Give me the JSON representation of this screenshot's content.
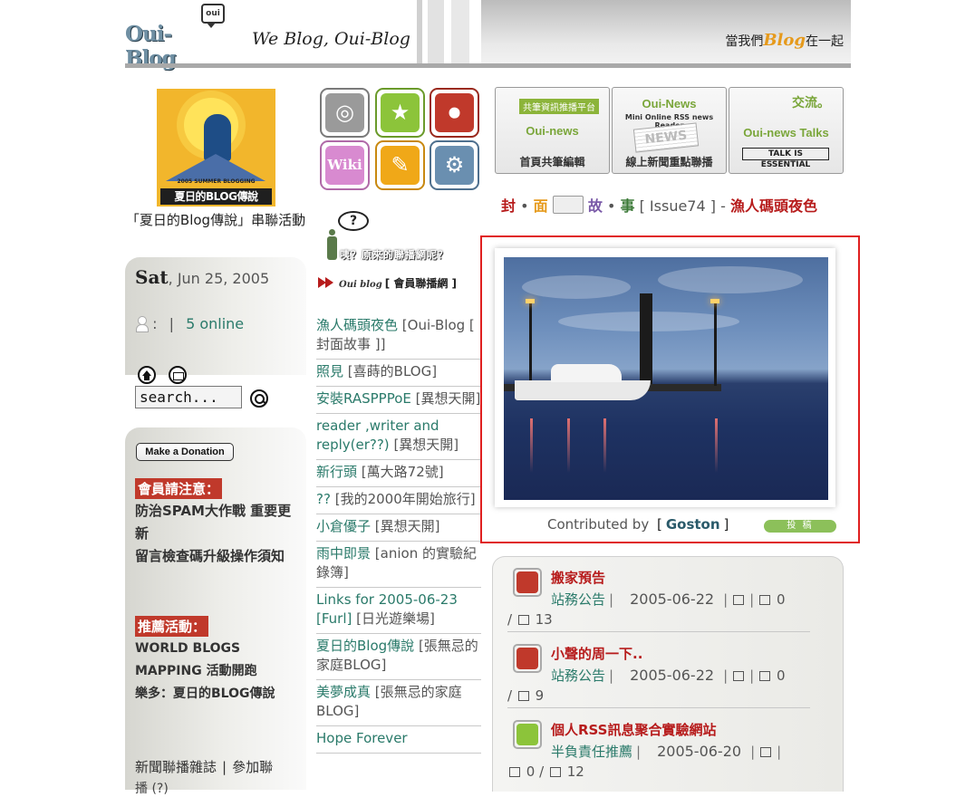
{
  "header": {
    "logo_text": "Oui-Blog",
    "logo_box": "oui",
    "slogan": "We Blog, Oui-Blog .",
    "tagline_pre": "當我們",
    "tagline_blog": "Blog",
    "tagline_post": "在一起"
  },
  "left": {
    "promo_small": "2005 SUMMER BLOGGING",
    "promo_banner": "夏日的BLOG傳說",
    "promo_caption": "「夏日的Blog傳說」串聯活動",
    "date_day": "Sat",
    "date_rest": ", Jun 25, 2005",
    "online_colon": ":",
    "online_sep": "|",
    "online_text": "5 online",
    "search_placeholder": "search...",
    "donate_label": "Make a Donation",
    "notice_head": "會員請注意：",
    "notices": [
      "防治SPAM大作戰 重要更新",
      "留言檢查碼升級操作須知"
    ],
    "promo_head": "推薦活動：",
    "promos": [
      "WORLD BLOGS MAPPING 活動開跑",
      "樂多：夏日的BLOG傳說"
    ],
    "footer_link1": "新聞聯播雜誌",
    "footer_sep": "|",
    "footer_link2": "參加聯",
    "footer_line2": "播 (?)"
  },
  "middle": {
    "tiles": [
      {
        "name": "camera-icon",
        "glyph": "◎",
        "bg": "#9a9a9a",
        "border": "#7a7a7a"
      },
      {
        "name": "star-icon",
        "glyph": "★",
        "bg": "#8cc43a",
        "border": "#6a9a2a"
      },
      {
        "name": "microphone-icon",
        "glyph": "⏺",
        "bg": "#c0392b",
        "border": "#9a2a1e"
      },
      {
        "name": "wiki-icon",
        "glyph": "Wiki",
        "bg": "#d88ad0",
        "border": "#b06aa8"
      },
      {
        "name": "edit-icon",
        "glyph": "✎",
        "bg": "#f0a818",
        "border": "#c88810"
      },
      {
        "name": "gear-icon",
        "glyph": "⚙",
        "bg": "#6a8fb0",
        "border": "#4f708e"
      }
    ],
    "bubble_text": "?",
    "question_text": "咦？原來的聯播網呢？",
    "cast_logo": "Oui blog",
    "cast_label": "[ 會員聯播網 ]",
    "feeds": [
      {
        "title": "漁人碼頭夜色",
        "source": "[Oui-Blog [ 封面故事 ]]"
      },
      {
        "title": "照見",
        "source": "[喜蒔的BLOG]"
      },
      {
        "title": "安裝RASPPPoE",
        "source": "[異想天開]"
      },
      {
        "title": "reader ,writer and reply(er??)",
        "source": "[異想天開]"
      },
      {
        "title": "新行頭",
        "source": "[萬大路72號]"
      },
      {
        "title": "??",
        "source": "[我的2000年開始旅行]"
      },
      {
        "title": "小倉優子",
        "source": "[異想天開]"
      },
      {
        "title": "雨中即景",
        "source": "[anion 的實驗紀錄簿]"
      },
      {
        "title": "Links for 2005-06-23 [Furl]",
        "source": "[日光遊樂場]"
      },
      {
        "title": "夏日的Blog傳說",
        "source": "[張無忌的家庭BLOG]"
      },
      {
        "title": "美夢成真",
        "source": "[張無忌的家庭BLOG]"
      },
      {
        "title": "Hope Forever",
        "source": ""
      }
    ]
  },
  "right": {
    "cards": [
      {
        "ribbon": "共筆資訊推播平台",
        "title": "Oui-news",
        "sub": "",
        "bottom": "首頁共筆編輯"
      },
      {
        "ribbon": "",
        "title": "Oui-News",
        "sub": "Mini Online RSS news Reader",
        "bottom": "線上新聞重點聯播"
      },
      {
        "ribbon": "交流。",
        "title": "Oui-news Talks",
        "sub": "",
        "bottom": "TALK IS ESSENTIAL"
      }
    ],
    "cover_feng": "封",
    "cover_dot1": "•",
    "cover_mian": "面",
    "cover_gu": "故",
    "cover_dot2": "•",
    "cover_shi": "事",
    "cover_issue": "[ Issue74 ] -",
    "cover_headline": "漁人碼頭夜色",
    "contrib_label": "Contributed by",
    "contrib_open": "[",
    "contrib_name": "Goston",
    "contrib_close": "]",
    "submit_label": "投 稿",
    "posts": [
      {
        "title": "搬家預告",
        "category": "站務公告",
        "date": "2005-06-22",
        "trackbacks": "0",
        "comments": "13",
        "icon_bg": "#c0392b"
      },
      {
        "title": "小聲的周一下..",
        "category": "站務公告",
        "date": "2005-06-22",
        "trackbacks": "0",
        "comments": "9",
        "icon_bg": "#c0392b"
      },
      {
        "title": "個人RSS訊息聚合實驗網站",
        "category": "半負責任推薦",
        "date": "2005-06-20",
        "trackbacks": "0",
        "comments": "12",
        "icon_bg": "#8cc43a"
      }
    ]
  },
  "colors": {
    "accent_red": "#b71c1c",
    "link_teal": "#2a7a6a",
    "highlight_border": "#e02020"
  }
}
